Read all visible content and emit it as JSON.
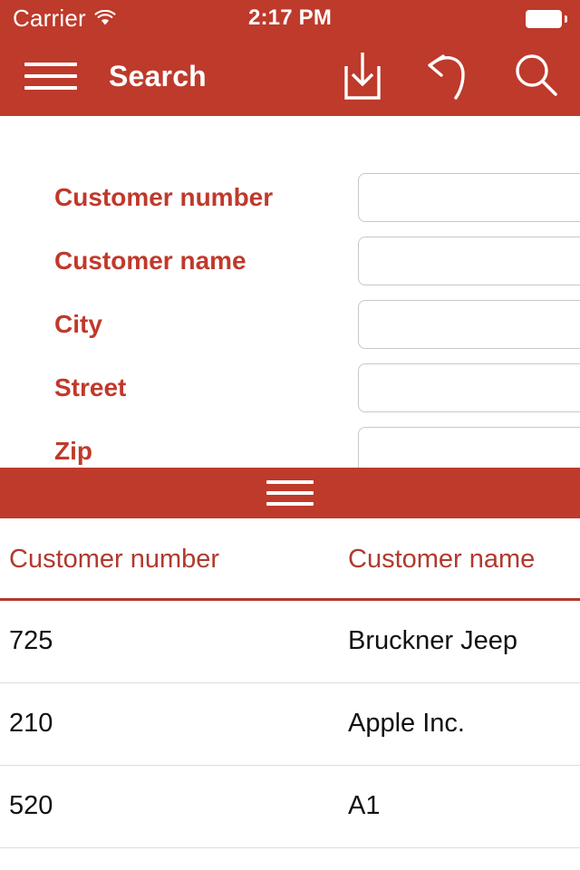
{
  "theme": {
    "accent": "#BE3A2B",
    "label_red": "#C0392B",
    "header_red": "#B03A2E",
    "background": "#FFFFFF",
    "text": "#111111",
    "border": "#C8C8C8"
  },
  "status_bar": {
    "carrier": "Carrier",
    "wifi_icon": "wifi-icon",
    "time": "2:17 PM",
    "battery_icon": "battery-full-icon"
  },
  "nav_bar": {
    "menu_icon": "hamburger-menu-icon",
    "title": "Search",
    "actions": [
      {
        "name": "save-button",
        "icon": "download-box-icon"
      },
      {
        "name": "undo-button",
        "icon": "undo-arrow-icon"
      },
      {
        "name": "search-button",
        "icon": "magnifier-icon"
      }
    ]
  },
  "form": {
    "fields": [
      {
        "label": "Customer number",
        "value": "",
        "placeholder": ""
      },
      {
        "label": "Customer name",
        "value": "",
        "placeholder": ""
      },
      {
        "label": "City",
        "value": "",
        "placeholder": ""
      },
      {
        "label": "Street",
        "value": "",
        "placeholder": ""
      },
      {
        "label": "Zip",
        "value": "",
        "placeholder": ""
      }
    ]
  },
  "splitter": {
    "grip_icon": "drag-handle-icon"
  },
  "results": {
    "columns": [
      "Customer number",
      "Customer name"
    ],
    "rows": [
      {
        "customer_number": "725",
        "customer_name": "Bruckner Jeep"
      },
      {
        "customer_number": "210",
        "customer_name": "Apple Inc."
      },
      {
        "customer_number": "520",
        "customer_name": "A1"
      }
    ]
  }
}
